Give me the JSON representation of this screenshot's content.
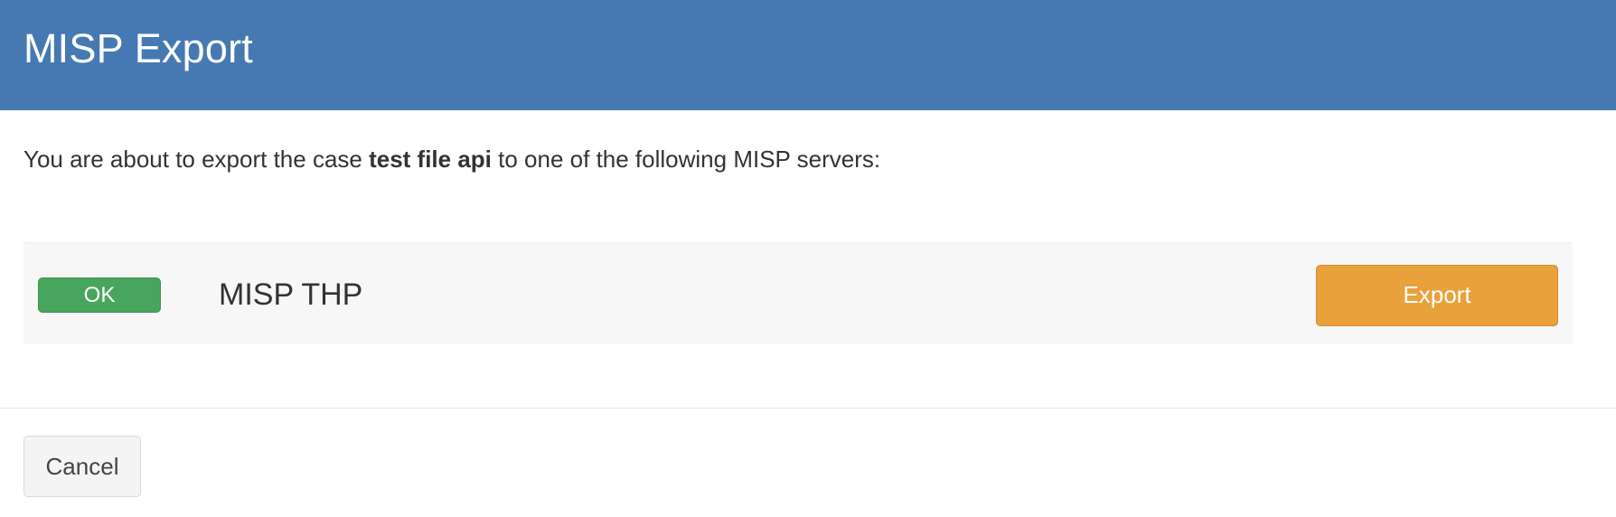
{
  "modal": {
    "title": "MISP Export"
  },
  "intro": {
    "prefix": "You are about to export the case ",
    "case_name": "test file api",
    "suffix": " to one of the following MISP servers:"
  },
  "servers": [
    {
      "status": "OK",
      "status_color": "#48a55d",
      "name": "MISP THP",
      "action_label": "Export",
      "action_color": "#e9a13b"
    }
  ],
  "footer": {
    "cancel_label": "Cancel"
  },
  "colors": {
    "header_bg": "#4679b2",
    "row_bg": "#f7f7f7"
  }
}
